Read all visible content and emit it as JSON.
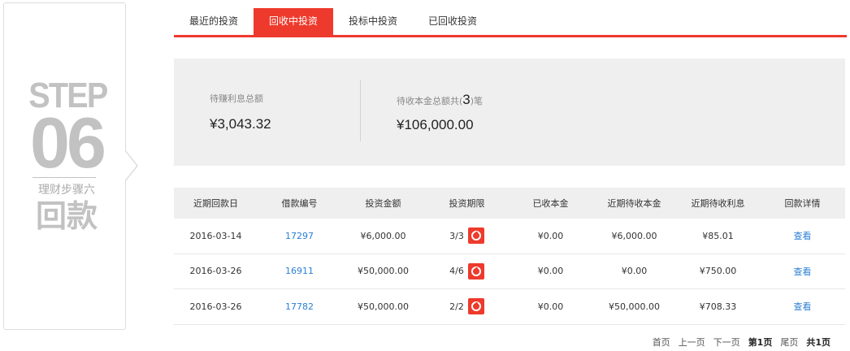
{
  "step": {
    "word": "STEP",
    "number": "06",
    "subtitle": "理财步骤六",
    "title": "回款"
  },
  "tabs": [
    {
      "label": "最近的投资",
      "active": false
    },
    {
      "label": "回收中投资",
      "active": true
    },
    {
      "label": "投标中投资",
      "active": false
    },
    {
      "label": "已回收投资",
      "active": false
    }
  ],
  "summary": {
    "interest_label": "待赚利息总额",
    "interest_value": "¥3,043.32",
    "principal_label_prefix": "待收本金总额共",
    "principal_label_open": "(",
    "principal_count": "3",
    "principal_label_suffix": ")笔",
    "principal_value": "¥106,000.00"
  },
  "table": {
    "headers": [
      "近期回款日",
      "借款编号",
      "投资金额",
      "投资期限",
      "已收本金",
      "近期待收本金",
      "近期待收利息",
      "回款详情"
    ],
    "rows": [
      {
        "date": "2016-03-14",
        "loan_id": "17297",
        "amount": "¥6,000.00",
        "period": "3/3",
        "received": "¥0.00",
        "pending_principal": "¥6,000.00",
        "pending_interest": "¥85.01",
        "detail": "查看"
      },
      {
        "date": "2016-03-26",
        "loan_id": "16911",
        "amount": "¥50,000.00",
        "period": "4/6",
        "received": "¥0.00",
        "pending_principal": "¥0.00",
        "pending_interest": "¥750.00",
        "detail": "查看"
      },
      {
        "date": "2016-03-26",
        "loan_id": "17782",
        "amount": "¥50,000.00",
        "period": "2/2",
        "received": "¥0.00",
        "pending_principal": "¥50,000.00",
        "pending_interest": "¥708.33",
        "detail": "查看"
      }
    ]
  },
  "pager": {
    "first": "首页",
    "prev": "上一页",
    "next": "下一页",
    "current": "第1页",
    "last": "尾页",
    "total": "共1页"
  },
  "colors": {
    "accent": "#ee3a2c",
    "link": "#2b7fd6",
    "panel_bg": "#efefef"
  },
  "icons": {
    "period_icon": "period-clock-icon"
  }
}
